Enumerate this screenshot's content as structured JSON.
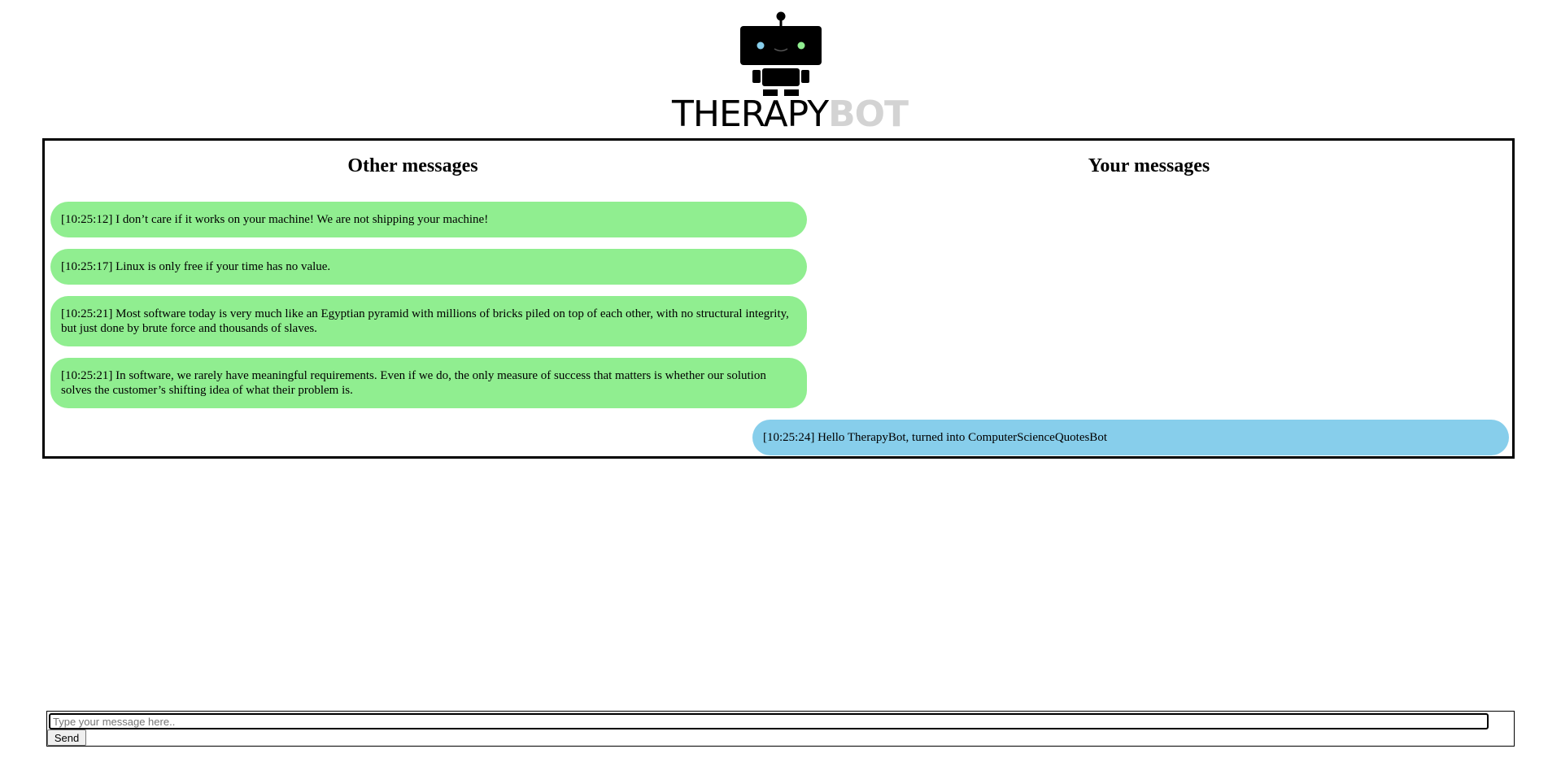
{
  "logo": {
    "text_part1": "THERAPY",
    "text_part2": "BOT",
    "accent_color": "#d3d3d3",
    "eye_left_color": "#87ceeb",
    "eye_right_color": "#90ee90"
  },
  "chat": {
    "heading_other": "Other messages",
    "heading_yours": "Your messages",
    "other_color": "#90ee90",
    "mine_color": "#87ceeb",
    "messages": [
      {
        "side": "other",
        "text": "[10:25:12] I don’t care if it works on your machine! We are not shipping your machine!"
      },
      {
        "side": "other",
        "text": "[10:25:17] Linux is only free if your time has no value."
      },
      {
        "side": "other",
        "text": "[10:25:21] Most software today is very much like an Egyptian pyramid with millions of bricks piled on top of each other, with no structural integrity, but just done by brute force and thousands of slaves."
      },
      {
        "side": "other",
        "text": "[10:25:21] In software, we rarely have meaningful requirements. Even if we do, the only measure of success that matters is whether our solution solves the customer’s shifting idea of what their problem is."
      },
      {
        "side": "mine",
        "text": "[10:25:24] Hello TherapyBot, turned into ComputerScienceQuotesBot"
      }
    ]
  },
  "composer": {
    "placeholder": "Type your message here..",
    "value": "",
    "send_label": "Send"
  }
}
